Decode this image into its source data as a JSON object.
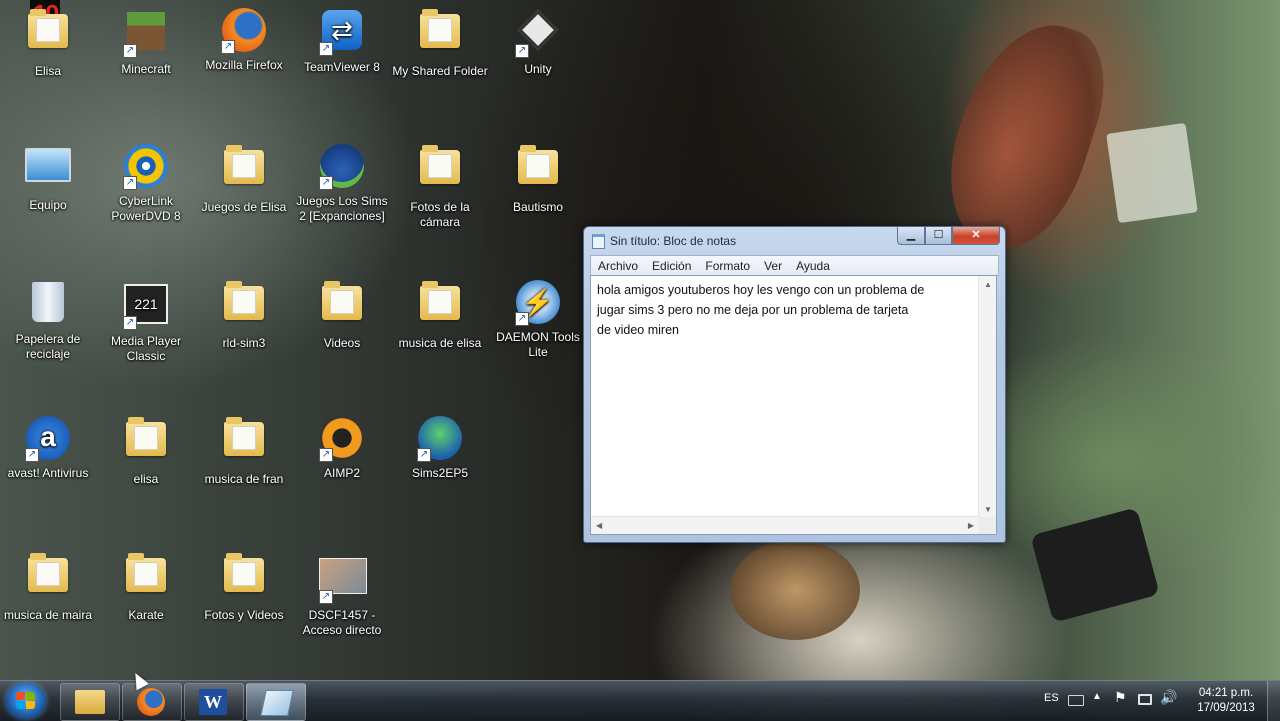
{
  "overlay_badge": "10",
  "desktop": {
    "icons": [
      {
        "label": "Elisa",
        "icon": "user-folder-icon"
      },
      {
        "label": "Minecraft",
        "icon": "minecraft-icon"
      },
      {
        "label": "Mozilla Firefox",
        "icon": "firefox-icon"
      },
      {
        "label": "TeamViewer 8",
        "icon": "teamviewer-icon"
      },
      {
        "label": "My Shared Folder",
        "icon": "folder-icon"
      },
      {
        "label": "Unity",
        "icon": "unity-icon"
      },
      {
        "label": "Equipo",
        "icon": "computer-icon"
      },
      {
        "label": "CyberLink PowerDVD 8",
        "icon": "powerdvd-icon"
      },
      {
        "label": "Juegos de Elisa",
        "icon": "folder-icon"
      },
      {
        "label": "Juegos Los Sims 2 [Expanciones]",
        "icon": "sims-icon"
      },
      {
        "label": "Fotos de la cámara",
        "icon": "folder-icon"
      },
      {
        "label": "Bautismo",
        "icon": "folder-icon"
      },
      {
        "label": "Papelera de reciclaje",
        "icon": "recycle-bin-icon"
      },
      {
        "label": "Media Player Classic",
        "icon": "media-player-icon"
      },
      {
        "label": "rld-sim3",
        "icon": "folder-icon"
      },
      {
        "label": "Videos",
        "icon": "folder-icon"
      },
      {
        "label": "musica de elisa",
        "icon": "folder-icon"
      },
      {
        "label": "DAEMON Tools Lite",
        "icon": "daemon-tools-icon"
      },
      {
        "label": "avast! Antivirus",
        "icon": "avast-icon"
      },
      {
        "label": "elisa",
        "icon": "folder-icon"
      },
      {
        "label": "musica de fran",
        "icon": "folder-icon"
      },
      {
        "label": "AIMP2",
        "icon": "aimp-icon"
      },
      {
        "label": "Sims2EP5",
        "icon": "sims2ep5-icon"
      },
      {
        "label": "musica de maira",
        "icon": "folder-icon"
      },
      {
        "label": "Karate",
        "icon": "folder-icon"
      },
      {
        "label": "Fotos y Videos",
        "icon": "folder-icon"
      },
      {
        "label": "DSCF1457 - Acceso directo",
        "icon": "photo-shortcut-icon"
      }
    ]
  },
  "notepad": {
    "title": "Sin título: Bloc de notas",
    "menu": [
      "Archivo",
      "Edición",
      "Formato",
      "Ver",
      "Ayuda"
    ],
    "content": "hola amigos youtuberos hoy les vengo con un problema de\njugar sims 3 pero no me deja por un problema de tarjeta\nde video miren"
  },
  "taskbar": {
    "pinned": [
      "explorer-icon",
      "firefox-icon",
      "word-icon",
      "notepad-icon"
    ],
    "language": "ES",
    "time": "04:21 p.m.",
    "date": "17/09/2013"
  },
  "colors": {
    "taskbar": "#1c232b",
    "close_button": "#c7432b",
    "notepad_frame": "#b5c9e3",
    "folder": "#e3b94c"
  }
}
